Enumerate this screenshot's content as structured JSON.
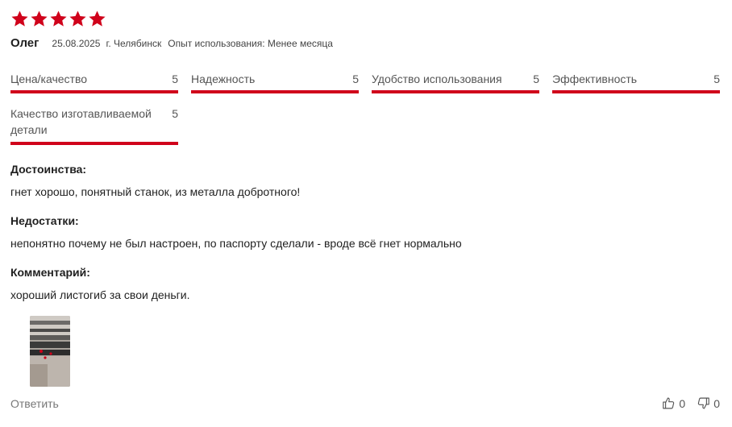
{
  "review": {
    "rating": 5,
    "rating_max": 5,
    "star_color": "#d0021b",
    "author": "Олег",
    "date": "25.08.2025",
    "city": "г. Челябинск",
    "experience": "Опыт использования: Менее месяца"
  },
  "ratings": [
    {
      "label": "Цена/качество",
      "value": "5"
    },
    {
      "label": "Надежность",
      "value": "5"
    },
    {
      "label": "Удобство использования",
      "value": "5"
    },
    {
      "label": "Эффективность",
      "value": "5"
    },
    {
      "label": "Качество изготавливаемой детали",
      "value": "5"
    }
  ],
  "sections": {
    "pros": {
      "title": "Достоинства:",
      "text": "гнет хорошо, понятный станок, из металла добротного!"
    },
    "cons": {
      "title": "Недостатки:",
      "text": "непонятно почему не был настроен, по паспорту сделали - вроде всё гнет нормально"
    },
    "comment": {
      "title": "Комментарий:",
      "text": "хороший листогиб за свои деньги."
    }
  },
  "actions": {
    "reply_label": "Ответить",
    "likes": "0",
    "dislikes": "0"
  },
  "icons": {
    "star": "star-icon",
    "like": "thumbs-up-icon",
    "dislike": "thumbs-down-icon"
  }
}
